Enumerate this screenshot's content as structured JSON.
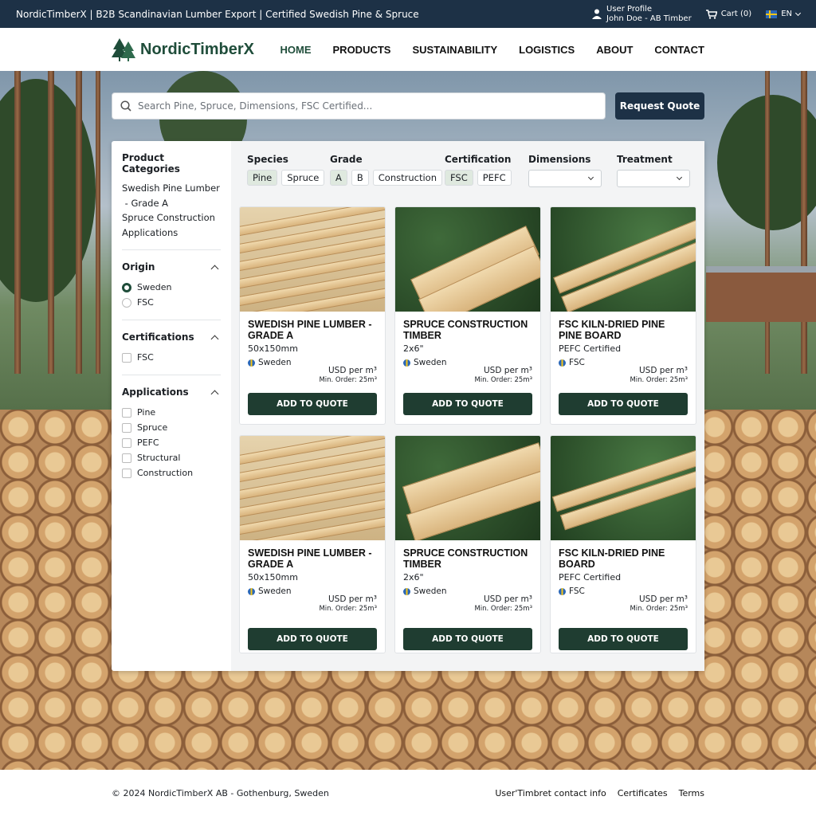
{
  "topbar": {
    "site_title": "NordicTimberX | B2B Scandinavian Lumber Export | Certified Swedish Pine & Spruce",
    "profile_label": "User Profile",
    "profile_name": "John Doe - AB Timber",
    "cart_label": "Cart (0)",
    "language": "EN",
    "icons": [
      "user-icon",
      "cart-icon",
      "sweden-flag-icon",
      "chevron-down-icon"
    ]
  },
  "nav": {
    "logo_text": "NordicTimberX",
    "links": [
      "HOME",
      "PRODUCTS",
      "SUSTAINABILITY",
      "LOGISTICS",
      "ABOUT",
      "CONTACT"
    ],
    "active": "HOME"
  },
  "search": {
    "placeholder": "Search Pine, Spruce, Dimensions, FSC Certified...",
    "quote_button": "Request Quote"
  },
  "sidebar": {
    "title": "Product Categories",
    "categories": [
      "Swedish Pine Lumber",
      " - Grade A",
      "Spruce Construction",
      "Applications"
    ],
    "origin": {
      "title": "Origin",
      "options": [
        "Sweden",
        "FSC"
      ],
      "selected": "Sweden"
    },
    "certifications": {
      "title": "Certifications",
      "options": [
        "FSC"
      ]
    },
    "applications": {
      "title": "Applications",
      "options": [
        "Pine",
        "Spruce",
        "PEFC",
        "Structural",
        "Construction"
      ]
    }
  },
  "filters": {
    "species": {
      "label": "Species",
      "options": [
        "Pine",
        "Spruce"
      ],
      "selected": "Pine"
    },
    "grade": {
      "label": "Grade",
      "options": [
        "A",
        "B",
        "Construction"
      ],
      "selected": "A"
    },
    "certification": {
      "label": "Certification",
      "options": [
        "FSC",
        "PEFC"
      ],
      "selected": "FSC"
    },
    "dimensions": {
      "label": "Dimensions",
      "value": ""
    },
    "treatment": {
      "label": "Treatment",
      "value": ""
    }
  },
  "products": [
    {
      "name": "Swedish Pine Lumber - Grade A",
      "spec": "50x150mm",
      "origin": "Sweden",
      "price": "USD per m³",
      "min_order": "Min. Order: 25m³",
      "button": "ADD TO QUOTE"
    },
    {
      "name": "Spruce Construction Timber",
      "spec": "2x6\"",
      "origin": "Sweden",
      "price": "USD per m³",
      "min_order": "Min. Order: 25m³",
      "button": "ADD TO QUOTE"
    },
    {
      "name": "FSC Kiln-Dried Pine Pine Board",
      "spec": "PEFC Certified",
      "origin": "FSC",
      "price": "USD per m³",
      "min_order": "Min. Order: 25m³",
      "button": "ADD TO QUOTE"
    },
    {
      "name": "Swedish Pine Lumber - Grade A",
      "spec": "50x150mm",
      "origin": "Sweden",
      "price": "USD per m³",
      "min_order": "Min. Order: 25m³",
      "button": "ADD TO QUOTE"
    },
    {
      "name": "Spruce Construction Timber",
      "spec": "2x6\"",
      "origin": "Sweden",
      "price": "USD per m³",
      "min_order": "Min. Order: 25m³",
      "button": "ADD TO QUOTE"
    },
    {
      "name": "FSC Kiln-Dried Pine Board",
      "spec": "PEFC Certified",
      "origin": "FSC",
      "price": "USD per m³",
      "min_order": "Min. Order: 25m³",
      "button": "ADD TO QUOTE"
    }
  ],
  "footer": {
    "copyright": "© 2024 NordicTimberX AB - Gothenburg, Sweden",
    "links": [
      "User'Timbret contact info",
      "Certificates",
      "Terms"
    ]
  },
  "colors": {
    "topbar": "#1d3146",
    "brand_green": "#1f4d3a",
    "button_dark": "#1f3d31"
  }
}
